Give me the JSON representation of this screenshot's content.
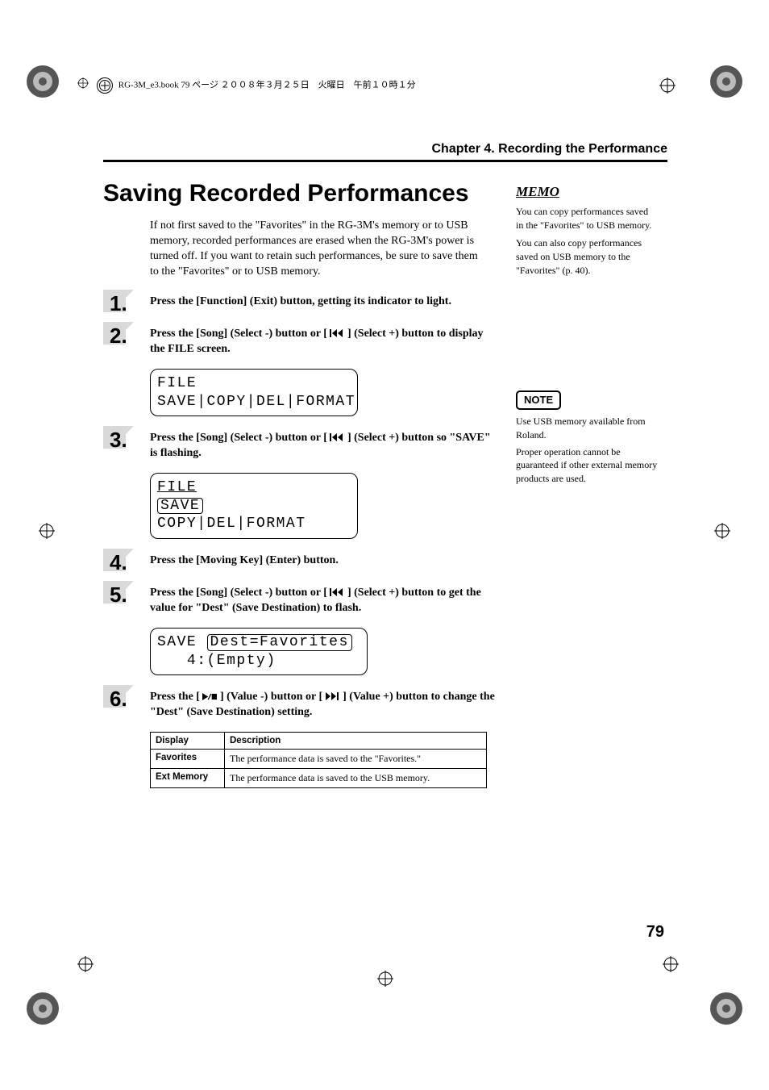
{
  "header_note": "RG-3M_e3.book  79 ページ  ２００８年３月２５日　火曜日　午前１０時１分",
  "chapter_title": "Chapter 4. Recording the Performance",
  "main_title": "Saving Recorded Performances",
  "intro": "If not first saved to the \"Favorites\" in the RG-3M's memory or to USB memory, recorded performances are erased when the RG-3M's power is turned off. If you want to retain such performances, be sure to save them to the \"Favorites\" or to USB memory.",
  "steps": [
    {
      "num": "1.",
      "text_before": "Press the [Function] (Exit) button, getting its indicator to light.",
      "text_after": ""
    },
    {
      "num": "2.",
      "text_before": "Press the [Song] (Select -) button or [",
      "text_after": "] (Select +) button to display the FILE screen."
    },
    {
      "num": "3.",
      "text_before": "Press the [Song] (Select -) button or [",
      "text_after": "] (Select +) button so \"SAVE\" is flashing."
    },
    {
      "num": "4.",
      "text_before": "Press the [Moving Key] (Enter) button.",
      "text_after": ""
    },
    {
      "num": "5.",
      "text_before": "Press the [Song] (Select -) button or [",
      "text_after": "] (Select +) button to get the value for \"Dest\" (Save Destination) to flash."
    },
    {
      "num": "6.",
      "text_before": "Press the [",
      "text_mid": "] (Value -) button or [",
      "text_after": "] (Value +) button to change the \"Dest\" (Save Destination) setting."
    }
  ],
  "lcd1": {
    "line1": "FILE",
    "line2": "SAVE|COPY|DEL|FORMAT"
  },
  "lcd2": {
    "line1": "FILE",
    "save": "SAVE",
    "rest": " COPY|DEL|FORMAT"
  },
  "lcd3": {
    "line1_left": "SAVE ",
    "line1_box": "Dest=Favorites",
    "line2": "   4:(Empty)"
  },
  "table": {
    "headers": [
      "Display",
      "Description"
    ],
    "rows": [
      [
        "Favorites",
        "The performance data is saved to the \"Favorites.\""
      ],
      [
        "Ext Memory",
        "The performance data is saved to the USB memory."
      ]
    ]
  },
  "sidebar": {
    "memo_label": "MEMO",
    "memo_p1": "You can copy performances saved in the \"Favorites\" to USB memory.",
    "memo_p2": "You can also copy performances saved on USB memory to the \"Favorites\" (p. 40).",
    "note_label": "NOTE",
    "note_p1": "Use USB memory available from Roland.",
    "note_p2": "Proper operation cannot be guaranteed if other external memory products are used."
  },
  "page_number": "79"
}
